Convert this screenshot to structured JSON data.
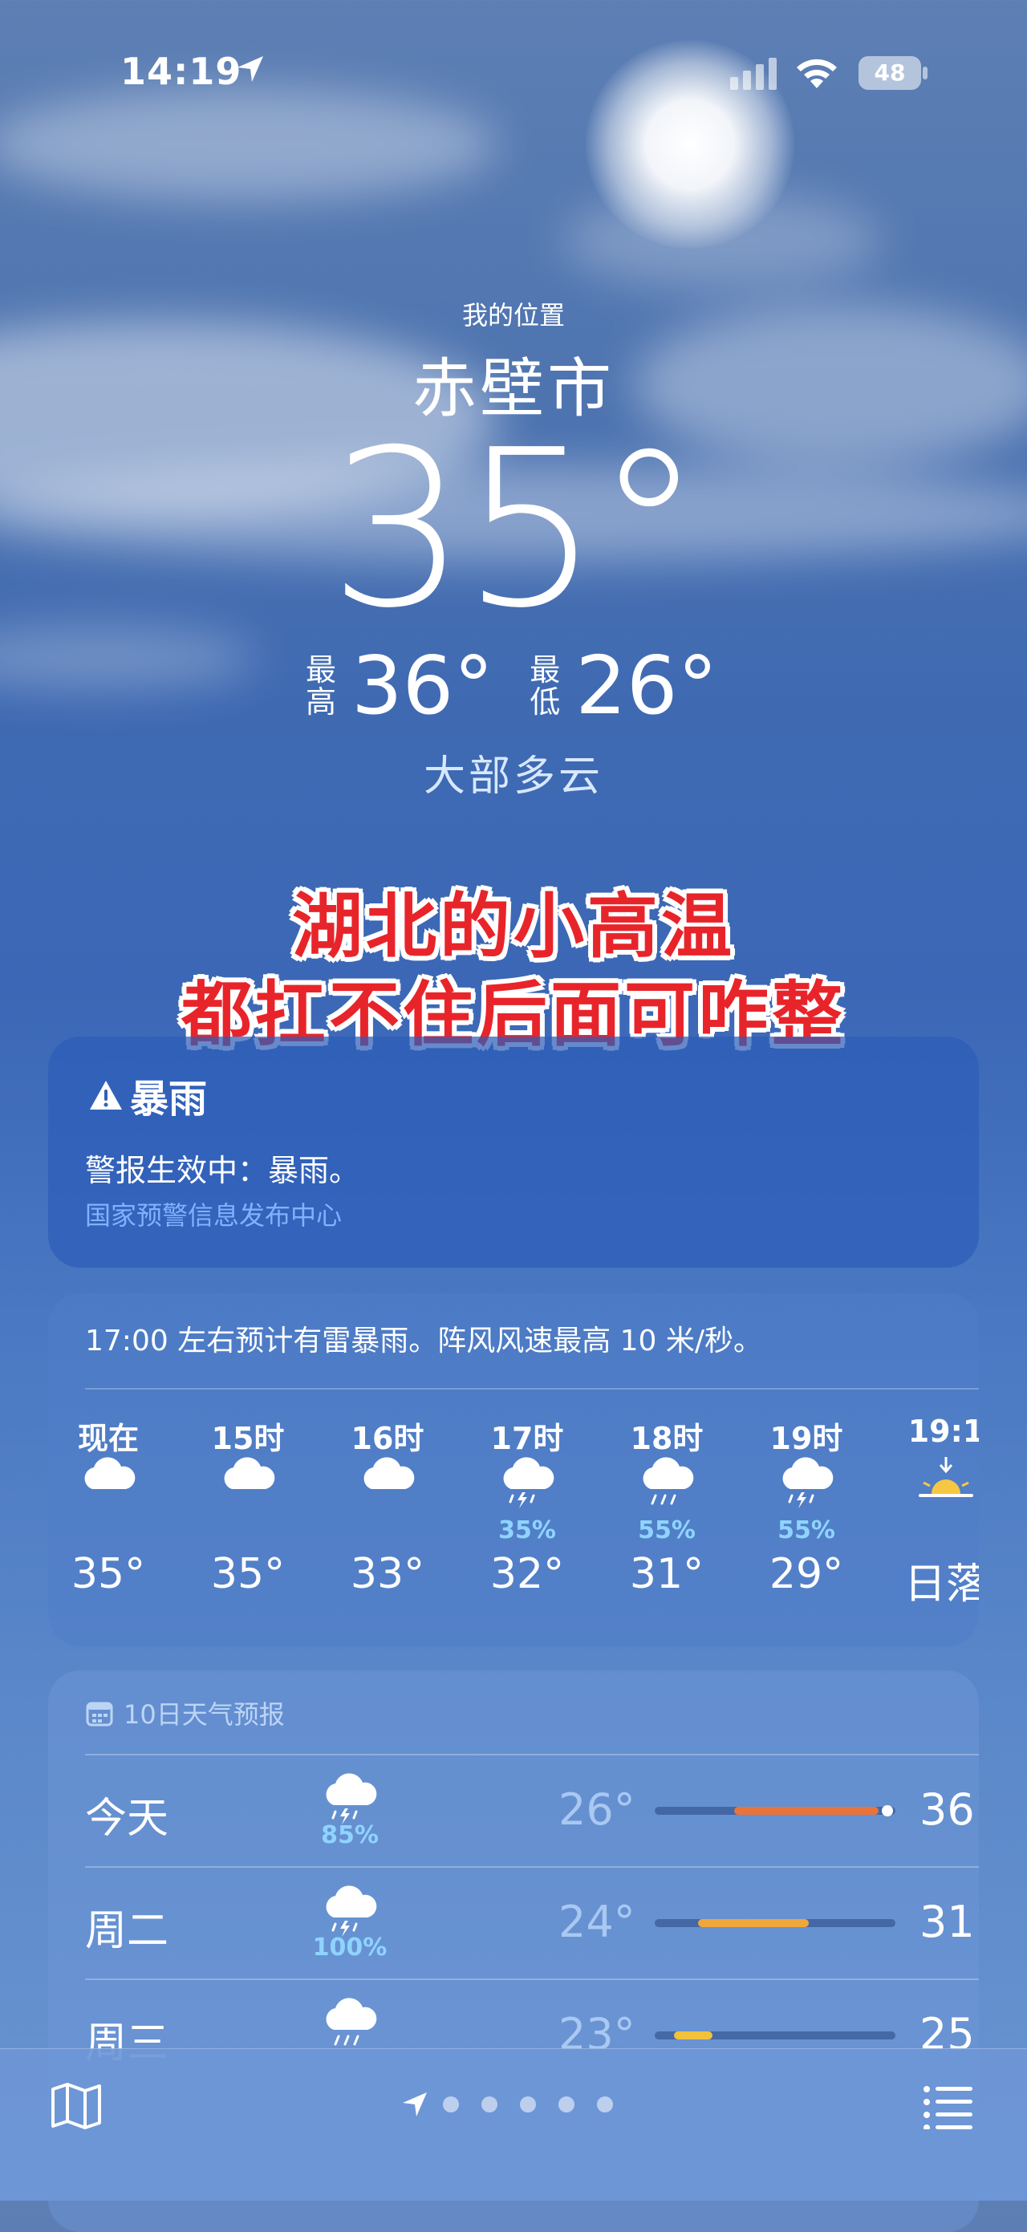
{
  "status_bar": {
    "time": "14:19",
    "battery": "48"
  },
  "header": {
    "location_label": "我的位置",
    "city": "赤壁市",
    "current_temp": "35°",
    "high_label": "最高",
    "high": "36°",
    "low_label": "最低",
    "low": "26°",
    "condition": "大部多云"
  },
  "overlay": {
    "line1": "湖北的小高温",
    "line2": "都扛不住后面可咋整"
  },
  "alert": {
    "icon": "warning-icon",
    "title": "暴雨",
    "body": "警报生效中：暴雨。",
    "source": "国家预警信息发布中心"
  },
  "hourly": {
    "summary": "17:00 左右预计有雷暴雨。阵风风速最高 10 米/秒。",
    "items": [
      {
        "label": "现在",
        "icon": "cloud-icon",
        "pop": "",
        "temp": "35°"
      },
      {
        "label": "15时",
        "icon": "cloud-icon",
        "pop": "",
        "temp": "35°"
      },
      {
        "label": "16时",
        "icon": "cloud-icon",
        "pop": "",
        "temp": "33°"
      },
      {
        "label": "17时",
        "icon": "thunderstorm-icon",
        "pop": "35%",
        "temp": "32°"
      },
      {
        "label": "18时",
        "icon": "rain-icon",
        "pop": "55%",
        "temp": "31°"
      },
      {
        "label": "19时",
        "icon": "thunderstorm-icon",
        "pop": "55%",
        "temp": "29°"
      },
      {
        "label": "19:1",
        "icon": "sunset-icon",
        "pop": "",
        "temp": "日落"
      }
    ]
  },
  "daily": {
    "header": "10日天气预报",
    "items": [
      {
        "day": "今天",
        "icon": "thunderstorm-icon",
        "pop": "85%",
        "low": "26°",
        "high": "36°",
        "bar_start": 0.33,
        "bar_end": 0.93,
        "color": "#e8743c",
        "show_dot": true
      },
      {
        "day": "周二",
        "icon": "thunderstorm-icon",
        "pop": "100%",
        "low": "24°",
        "high": "31°",
        "bar_start": 0.18,
        "bar_end": 0.64,
        "color": "#f0a73a",
        "show_dot": false
      },
      {
        "day": "周三",
        "icon": "rain-icon",
        "pop": "",
        "low": "23°",
        "high": "25°",
        "bar_start": 0.08,
        "bar_end": 0.24,
        "color": "#f2c23b",
        "show_dot": false
      }
    ]
  },
  "colors": {
    "accent_pop": "#8fd4ff",
    "alert_source": "#7fb2ff",
    "overlay_text": "#e8242b"
  }
}
